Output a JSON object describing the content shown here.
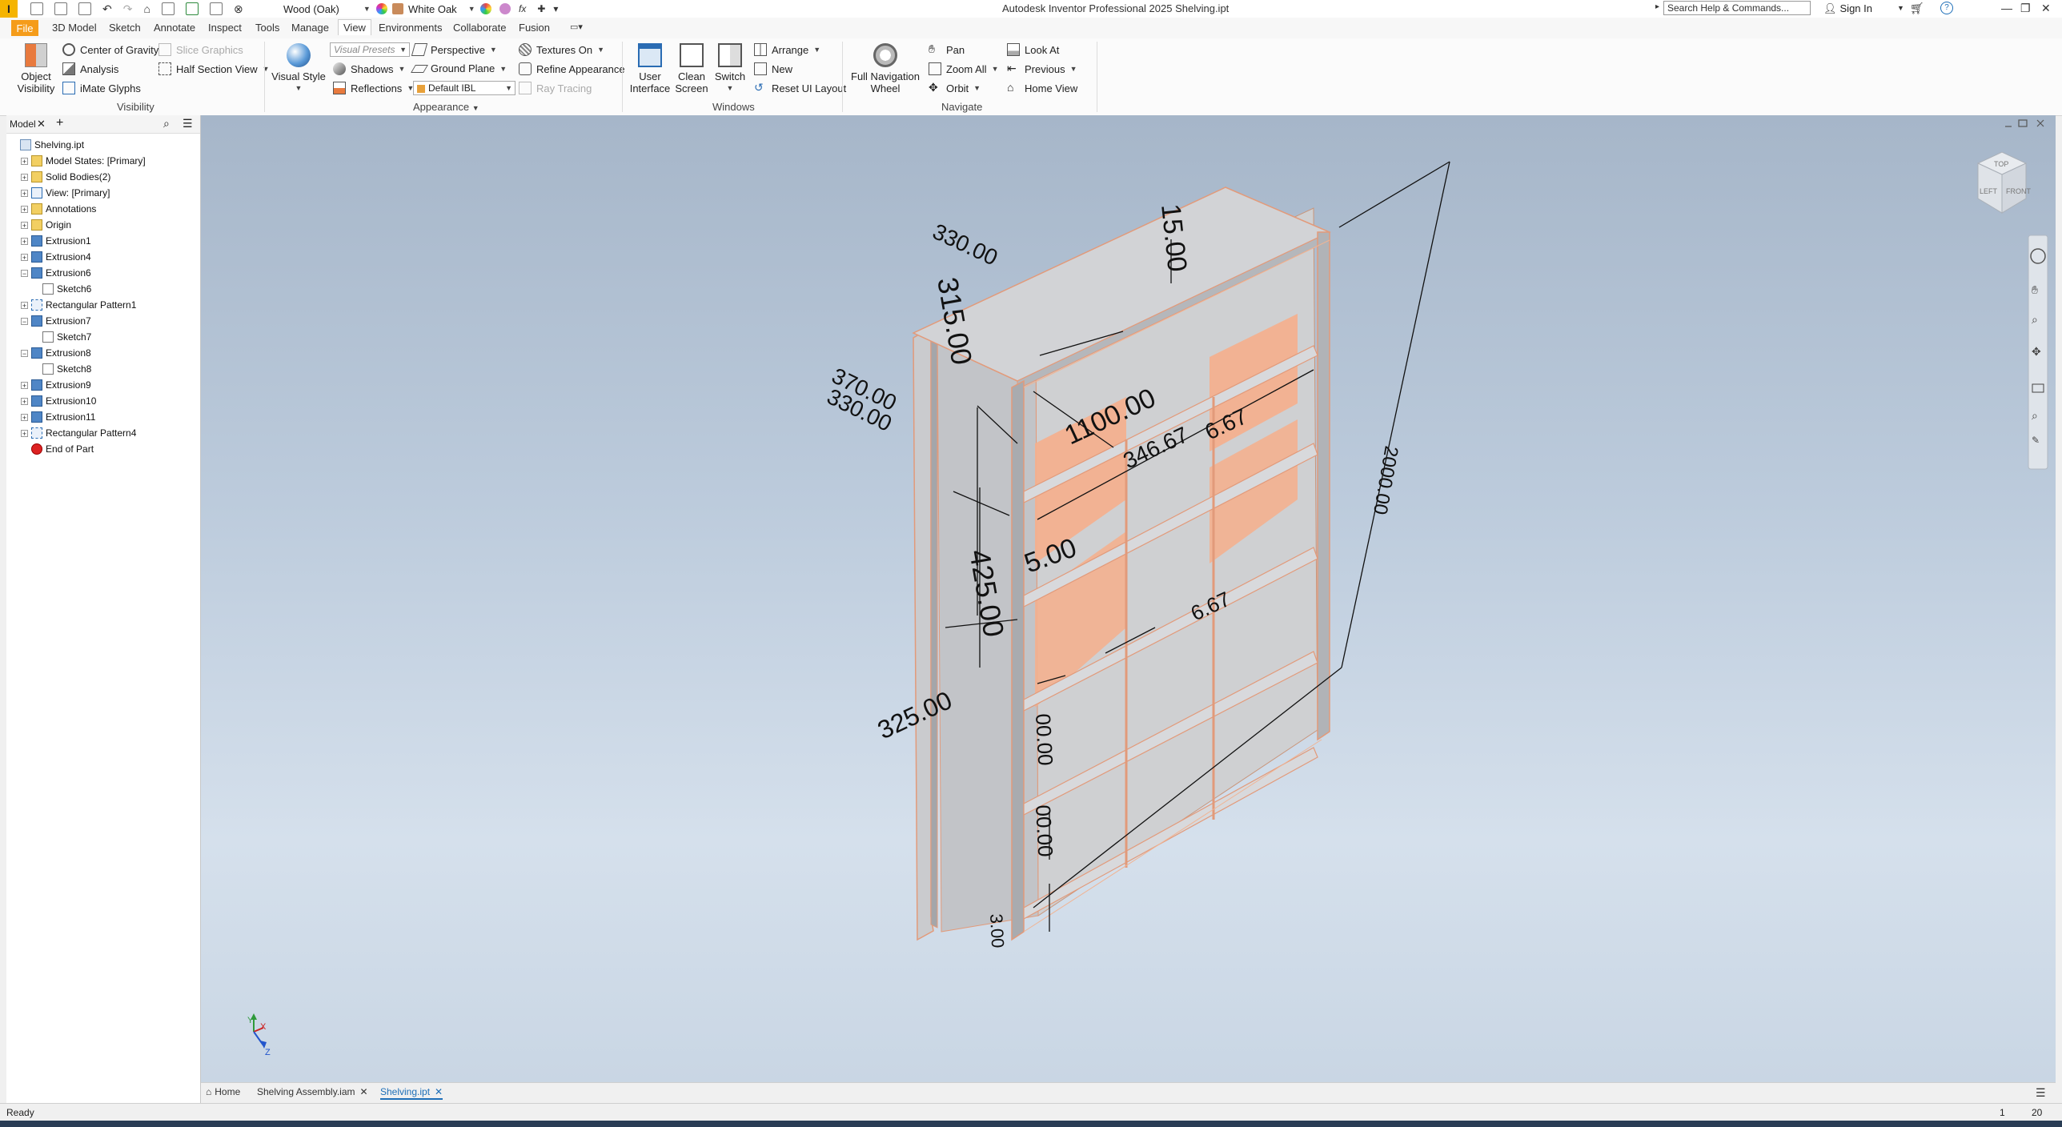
{
  "titlebar": {
    "app_title": "Autodesk Inventor Professional 2025   Shelving.ipt",
    "material": "Wood (Oak)",
    "appearance": "White Oak",
    "search_placeholder": "Search Help & Commands...",
    "sign_in": "Sign In",
    "logo_letter": "I",
    "fx": "fx"
  },
  "menu": {
    "tabs": [
      "File",
      "3D Model",
      "Sketch",
      "Annotate",
      "Inspect",
      "Tools",
      "Manage",
      "View",
      "Environments",
      "Collaborate",
      "Fusion"
    ],
    "active": "View"
  },
  "ribbon": {
    "visibility": {
      "label": "Visibility",
      "object_visibility": "Object\nVisibility",
      "center_of_gravity": "Center of Gravity",
      "slice_graphics": "Slice Graphics",
      "analysis": "Analysis",
      "half_section_view": "Half Section View",
      "imate_glyphs": "iMate Glyphs"
    },
    "appearance": {
      "label": "Appearance",
      "visual_style": "Visual Style",
      "visual_presets": "Visual Presets",
      "perspective": "Perspective",
      "textures_on": "Textures On",
      "shadows": "Shadows",
      "ground_plane": "Ground Plane",
      "refine_appearance": "Refine Appearance",
      "reflections": "Reflections",
      "ibl": "Default IBL",
      "ray_tracing": "Ray Tracing"
    },
    "windows": {
      "label": "Windows",
      "user_interface": "User\nInterface",
      "clean_screen": "Clean\nScreen",
      "switch": "Switch",
      "arrange": "Arrange",
      "new": "New",
      "reset_ui_layout": "Reset UI Layout"
    },
    "navigate": {
      "label": "Navigate",
      "full_navigation_wheel": "Full Navigation\nWheel",
      "pan": "Pan",
      "zoom_all": "Zoom All",
      "orbit": "Orbit",
      "look_at": "Look At",
      "previous": "Previous",
      "home_view": "Home View"
    }
  },
  "model_panel": {
    "title": "Model",
    "tree": [
      {
        "label": "Shelving.ipt",
        "indent": 0,
        "expander": "",
        "icon": "part"
      },
      {
        "label": "Model States: [Primary]",
        "indent": 1,
        "expander": "+",
        "icon": "folder"
      },
      {
        "label": "Solid Bodies(2)",
        "indent": 1,
        "expander": "+",
        "icon": "folder"
      },
      {
        "label": "View: [Primary]",
        "indent": 1,
        "expander": "+",
        "icon": "view"
      },
      {
        "label": "Annotations",
        "indent": 1,
        "expander": "+",
        "icon": "annot"
      },
      {
        "label": "Origin",
        "indent": 1,
        "expander": "+",
        "icon": "folder"
      },
      {
        "label": "Extrusion1",
        "indent": 1,
        "expander": "+",
        "icon": "extrude"
      },
      {
        "label": "Extrusion4",
        "indent": 1,
        "expander": "+",
        "icon": "extrude"
      },
      {
        "label": "Extrusion6",
        "indent": 1,
        "expander": "−",
        "icon": "extrude"
      },
      {
        "label": "Sketch6",
        "indent": 2,
        "expander": "",
        "icon": "sketch"
      },
      {
        "label": "Rectangular Pattern1",
        "indent": 1,
        "expander": "+",
        "icon": "pattern"
      },
      {
        "label": "Extrusion7",
        "indent": 1,
        "expander": "−",
        "icon": "extrude"
      },
      {
        "label": "Sketch7",
        "indent": 2,
        "expander": "",
        "icon": "sketch"
      },
      {
        "label": "Extrusion8",
        "indent": 1,
        "expander": "−",
        "icon": "extrude"
      },
      {
        "label": "Sketch8",
        "indent": 2,
        "expander": "",
        "icon": "sketch"
      },
      {
        "label": "Extrusion9",
        "indent": 1,
        "expander": "+",
        "icon": "extrude"
      },
      {
        "label": "Extrusion10",
        "indent": 1,
        "expander": "+",
        "icon": "extrude"
      },
      {
        "label": "Extrusion11",
        "indent": 1,
        "expander": "+",
        "icon": "extrude"
      },
      {
        "label": "Rectangular Pattern4",
        "indent": 1,
        "expander": "+",
        "icon": "pattern"
      },
      {
        "label": "End of Part",
        "indent": 1,
        "expander": "",
        "icon": "end"
      }
    ]
  },
  "viewport": {
    "dimensions": [
      "15.00",
      "330.00",
      "315.00",
      "370.00",
      "330.00",
      "1100.00",
      "346.67",
      "6.67",
      "425.00",
      "5.00",
      "6.67",
      "325.00",
      "2000.00",
      "00.00",
      "00.00",
      "3.00"
    ],
    "viewcube": {
      "top": "TOP",
      "left": "LEFT",
      "front": "FRONT"
    },
    "axis_labels": {
      "x": "X",
      "y": "Y",
      "z": "Z"
    }
  },
  "doc_tabs": [
    {
      "label": "Home"
    },
    {
      "label": "Shelving Assembly.iam"
    },
    {
      "label": "Shelving.ipt"
    }
  ],
  "status": {
    "text": "Ready",
    "count1": "1",
    "count2": "20"
  },
  "colors": {
    "accent": "#f59c1a",
    "shelf_back": "#f3b08f",
    "model_face": "#d9dadb",
    "viewport_top": "#a6b6c9"
  }
}
